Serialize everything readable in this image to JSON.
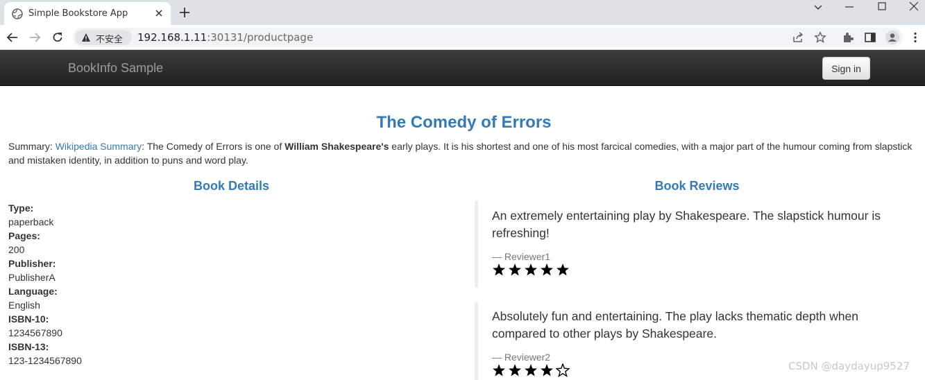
{
  "browser": {
    "tab_title": "Simple Bookstore App",
    "security_label": "不安全",
    "url_host": "192.168.1.11",
    "url_rest": ":30131/productpage"
  },
  "navbar": {
    "brand": "BookInfo Sample",
    "signin_label": "Sign in"
  },
  "book": {
    "title": "The Comedy of Errors",
    "summary_prefix": "Summary: ",
    "summary_link": "Wikipedia Summary",
    "summary_text_1": ": The Comedy of Errors is one of ",
    "summary_bold": "William Shakespeare's",
    "summary_text_2": " early plays. It is his shortest and one of his most farcical comedies, with a major part of the humour coming from slapstick and mistaken identity, in addition to puns and word play."
  },
  "details": {
    "heading": "Book Details",
    "type_label": "Type:",
    "type_value": "paperback",
    "pages_label": "Pages:",
    "pages_value": "200",
    "publisher_label": "Publisher:",
    "publisher_value": "PublisherA",
    "language_label": "Language:",
    "language_value": "English",
    "isbn10_label": "ISBN-10:",
    "isbn10_value": "1234567890",
    "isbn13_label": "ISBN-13:",
    "isbn13_value": "123-1234567890"
  },
  "reviews": {
    "heading": "Book Reviews",
    "items": [
      {
        "text": "An extremely entertaining play by Shakespeare. The slapstick humour is refreshing!",
        "reviewer": "— Reviewer1",
        "rating": 5,
        "max_rating": 5
      },
      {
        "text": "Absolutely fun and entertaining. The play lacks thematic depth when compared to other plays by Shakespeare.",
        "reviewer": "— Reviewer2",
        "rating": 4,
        "max_rating": 5
      }
    ]
  },
  "watermark": "CSDN @daydayup9527",
  "colors": {
    "link": "#337ab7",
    "navbar_bg": "#222222",
    "brand": "#9d9d9d",
    "star": "#000000"
  }
}
